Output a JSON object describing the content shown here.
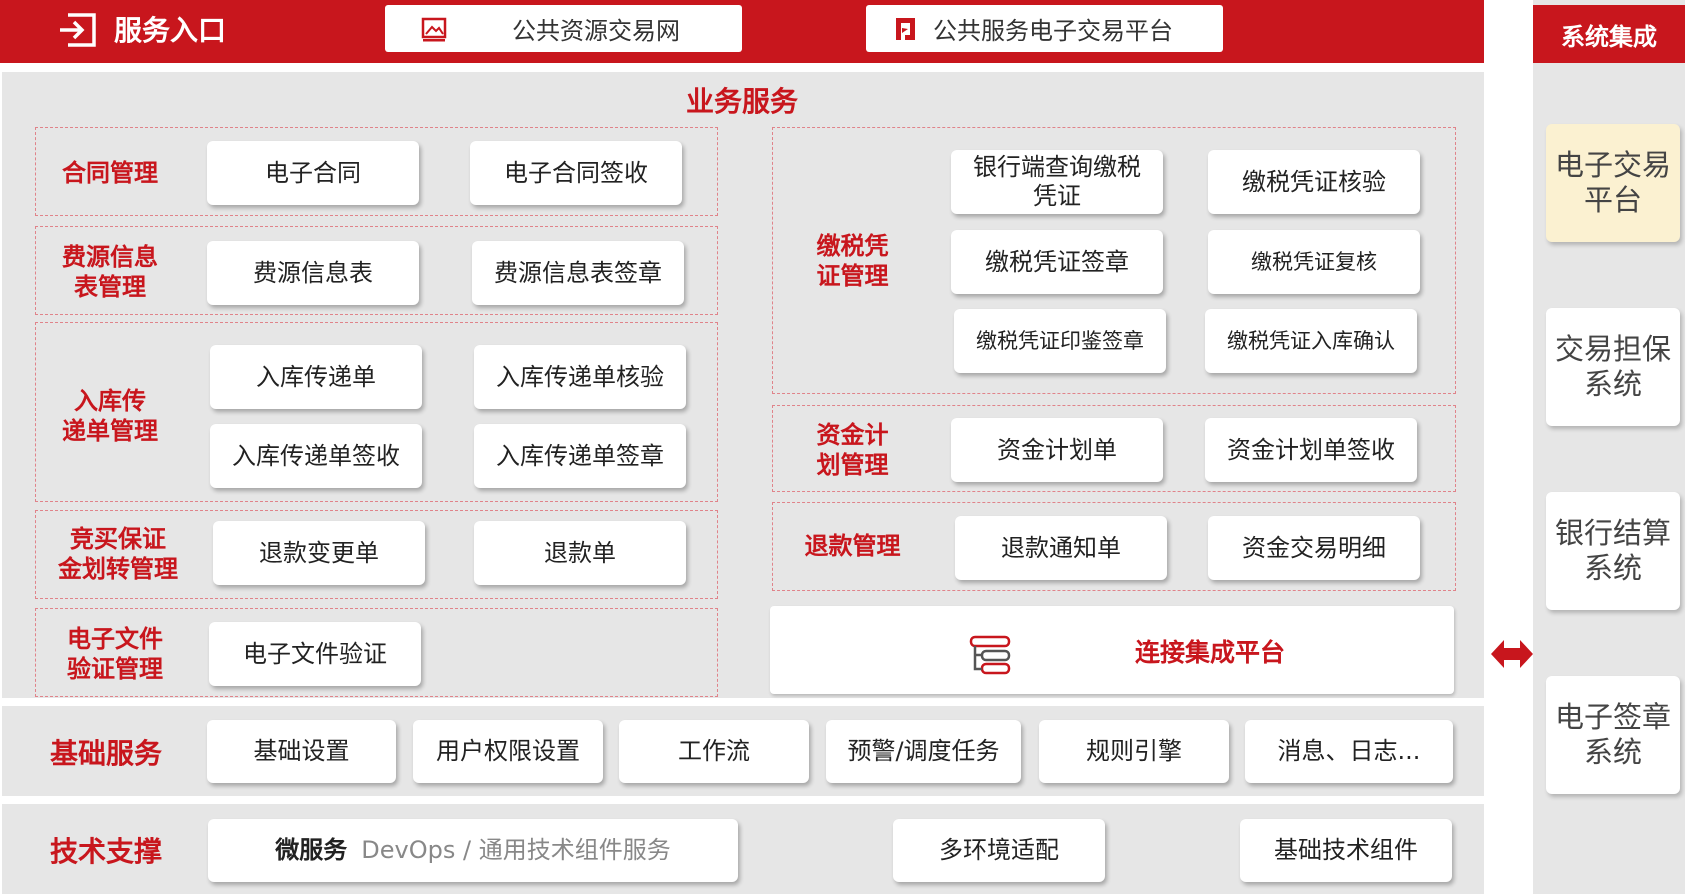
{
  "header": {
    "entry_title": "服务入口",
    "link1": "公共资源交易网",
    "link2": "公共服务电子交易平台"
  },
  "business": {
    "title": "业务服务",
    "left_groups": [
      {
        "label": "合同管理",
        "items": [
          "电子合同",
          "电子合同签收"
        ]
      },
      {
        "label": "费源信息\n表管理",
        "items": [
          "费源信息表",
          "费源信息表签章"
        ]
      },
      {
        "label": "入库传\n递单管理",
        "items": [
          "入库传递单",
          "入库传递单核验",
          "入库传递单签收",
          "入库传递单签章"
        ]
      },
      {
        "label": "竞买保证\n金划转管理",
        "items": [
          "退款变更单",
          "退款单"
        ]
      },
      {
        "label": "电子文件\n验证管理",
        "items": [
          "电子文件验证"
        ]
      }
    ],
    "right_groups": [
      {
        "label": "缴税凭\n证管理",
        "items": [
          "银行端查询缴税\n凭证",
          "缴税凭证核验",
          "缴税凭证签章",
          "缴税凭证复核",
          "缴税凭证印鉴签章",
          "缴税凭证入库确认"
        ]
      },
      {
        "label": "资金计\n划管理",
        "items": [
          "资金计划单",
          "资金计划单签收"
        ]
      },
      {
        "label": "退款管理",
        "items": [
          "退款通知单",
          "资金交易明细"
        ]
      }
    ],
    "integration_label": "连接集成平台"
  },
  "basic_services": {
    "label": "基础服务",
    "items": [
      "基础设置",
      "用户权限设置",
      "工作流",
      "预警/调度任务",
      "规则引擎",
      "消息、日志..."
    ]
  },
  "tech_support": {
    "label": "技术支撑",
    "micro_bold": "微服务",
    "micro_rest": "DevOps / 通用技术组件服务",
    "items": [
      "多环境适配",
      "基础技术组件"
    ]
  },
  "system_integration": {
    "title": "系统集成",
    "items": [
      "电子交易\n平台",
      "交易担保\n系统",
      "银行结算\n系统",
      "电子签章\n系统"
    ]
  },
  "colors": {
    "brand_red": "#c8161d",
    "panel_gray": "#e6e6e6",
    "highlight": "#fbf1d1"
  },
  "icons": [
    "exit-icon",
    "image-icon",
    "red-logo-icon",
    "list-icon",
    "double-arrow-icon"
  ]
}
